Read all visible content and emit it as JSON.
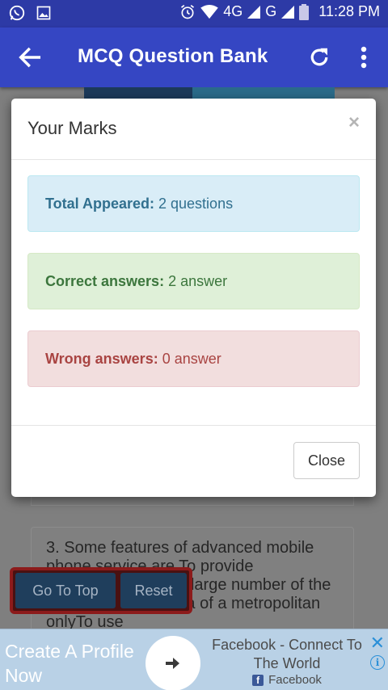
{
  "status_bar": {
    "network": "4G",
    "network2": "G",
    "time": "11:28 PM"
  },
  "app_bar": {
    "title": "MCQ Question Bank"
  },
  "background": {
    "question_text": "3. Some features of advanced mobile phone service are To provide communication to a large number of the users within the area of a metropolitan onlyTo use",
    "go_to_top_label": "Go To Top",
    "reset_label": "Reset"
  },
  "modal": {
    "title": "Your Marks",
    "close_x": "×",
    "total": {
      "label": "Total Appeared:",
      "value": "2 questions"
    },
    "correct": {
      "label": "Correct answers:",
      "value": "2 answer"
    },
    "wrong": {
      "label": "Wrong answers:",
      "value": "0 answer"
    },
    "close_label": "Close"
  },
  "ad": {
    "left_text": "Create A Profile Now",
    "headline": "Facebook - Connect To The World",
    "source": "Facebook",
    "fb_letter": "f",
    "close_x": "✕",
    "info": "i"
  },
  "colors": {
    "status_bar": "#2d3aa6",
    "app_bar": "#3546c3",
    "info_bg": "#d9edf7",
    "success_bg": "#dff0d8",
    "danger_bg": "#f2dede"
  }
}
